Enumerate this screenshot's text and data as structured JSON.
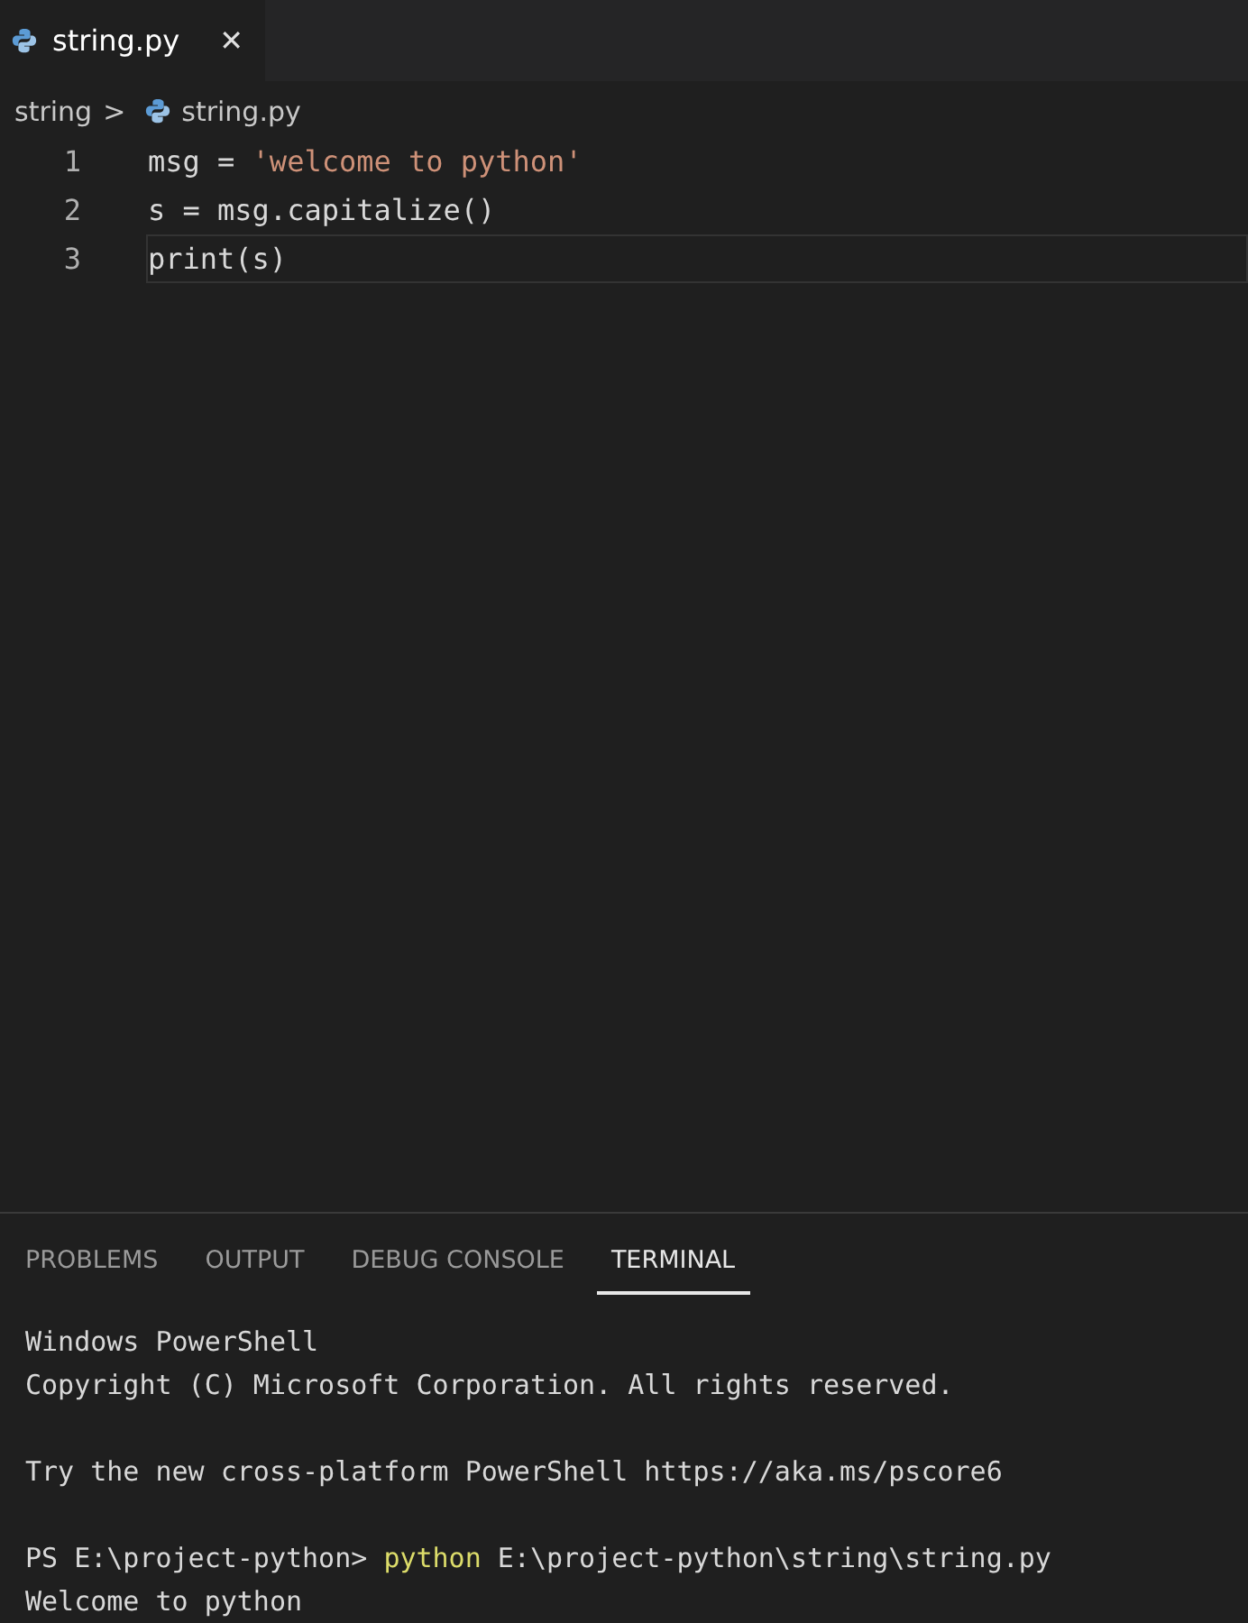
{
  "tabs": [
    {
      "label": "string.py",
      "close": "✕",
      "selected": true
    }
  ],
  "breadcrumb": {
    "folder": "string",
    "separator": ">",
    "file": "string.py"
  },
  "code": [
    {
      "number": "1",
      "current": false,
      "tokens": [
        {
          "kind": "text",
          "text": "msg = "
        },
        {
          "kind": "string",
          "text": "'welcome to python'"
        }
      ]
    },
    {
      "number": "2",
      "current": false,
      "tokens": [
        {
          "kind": "text",
          "text": "s = msg.capitalize()"
        }
      ]
    },
    {
      "number": "3",
      "current": true,
      "tokens": [
        {
          "kind": "text",
          "text": "print(s)"
        }
      ]
    }
  ],
  "panel_tabs": [
    {
      "label": "PROBLEMS",
      "selected": false
    },
    {
      "label": "OUTPUT",
      "selected": false
    },
    {
      "label": "DEBUG CONSOLE",
      "selected": false
    },
    {
      "label": "TERMINAL",
      "selected": true
    }
  ],
  "terminal": [
    {
      "kind": "output",
      "segments": [
        {
          "kind": "text",
          "text": "Windows PowerShell"
        }
      ]
    },
    {
      "kind": "output",
      "segments": [
        {
          "kind": "text",
          "text": "Copyright (C) Microsoft Corporation. All rights reserved."
        }
      ]
    },
    {
      "kind": "blank"
    },
    {
      "kind": "output",
      "segments": [
        {
          "kind": "text",
          "text": "Try the new cross-platform PowerShell https://aka.ms/pscore6"
        }
      ]
    },
    {
      "kind": "blank"
    },
    {
      "kind": "output",
      "segments": [
        {
          "kind": "text",
          "text": "PS E:\\project-python> "
        },
        {
          "kind": "command",
          "text": "python"
        },
        {
          "kind": "text",
          "text": " E:\\project-python\\string\\string.py"
        }
      ]
    },
    {
      "kind": "output",
      "segments": [
        {
          "kind": "text",
          "text": "Welcome to python"
        }
      ]
    }
  ]
}
